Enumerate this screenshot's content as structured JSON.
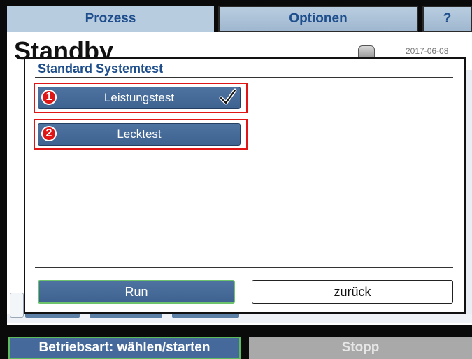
{
  "tabs": {
    "prozess": "Prozess",
    "optionen": "Optionen",
    "help": "?"
  },
  "background": {
    "status_title": "Standby",
    "date": "2017-06-08"
  },
  "dialog": {
    "title": "Standard Systemtest",
    "options": [
      {
        "number": "1",
        "label": "Leistungstest",
        "checked": true
      },
      {
        "number": "2",
        "label": "Lecktest",
        "checked": false
      }
    ],
    "run_label": "Run",
    "back_label": "zurück"
  },
  "bottom_bar": {
    "mode_label": "Betriebsart: wählen/starten",
    "stop_label": "Stopp"
  },
  "colors": {
    "accent_blue": "#45699a",
    "title_blue": "#1e4e8c",
    "highlight_red": "#e01515",
    "focus_green": "#5dbb5d"
  }
}
